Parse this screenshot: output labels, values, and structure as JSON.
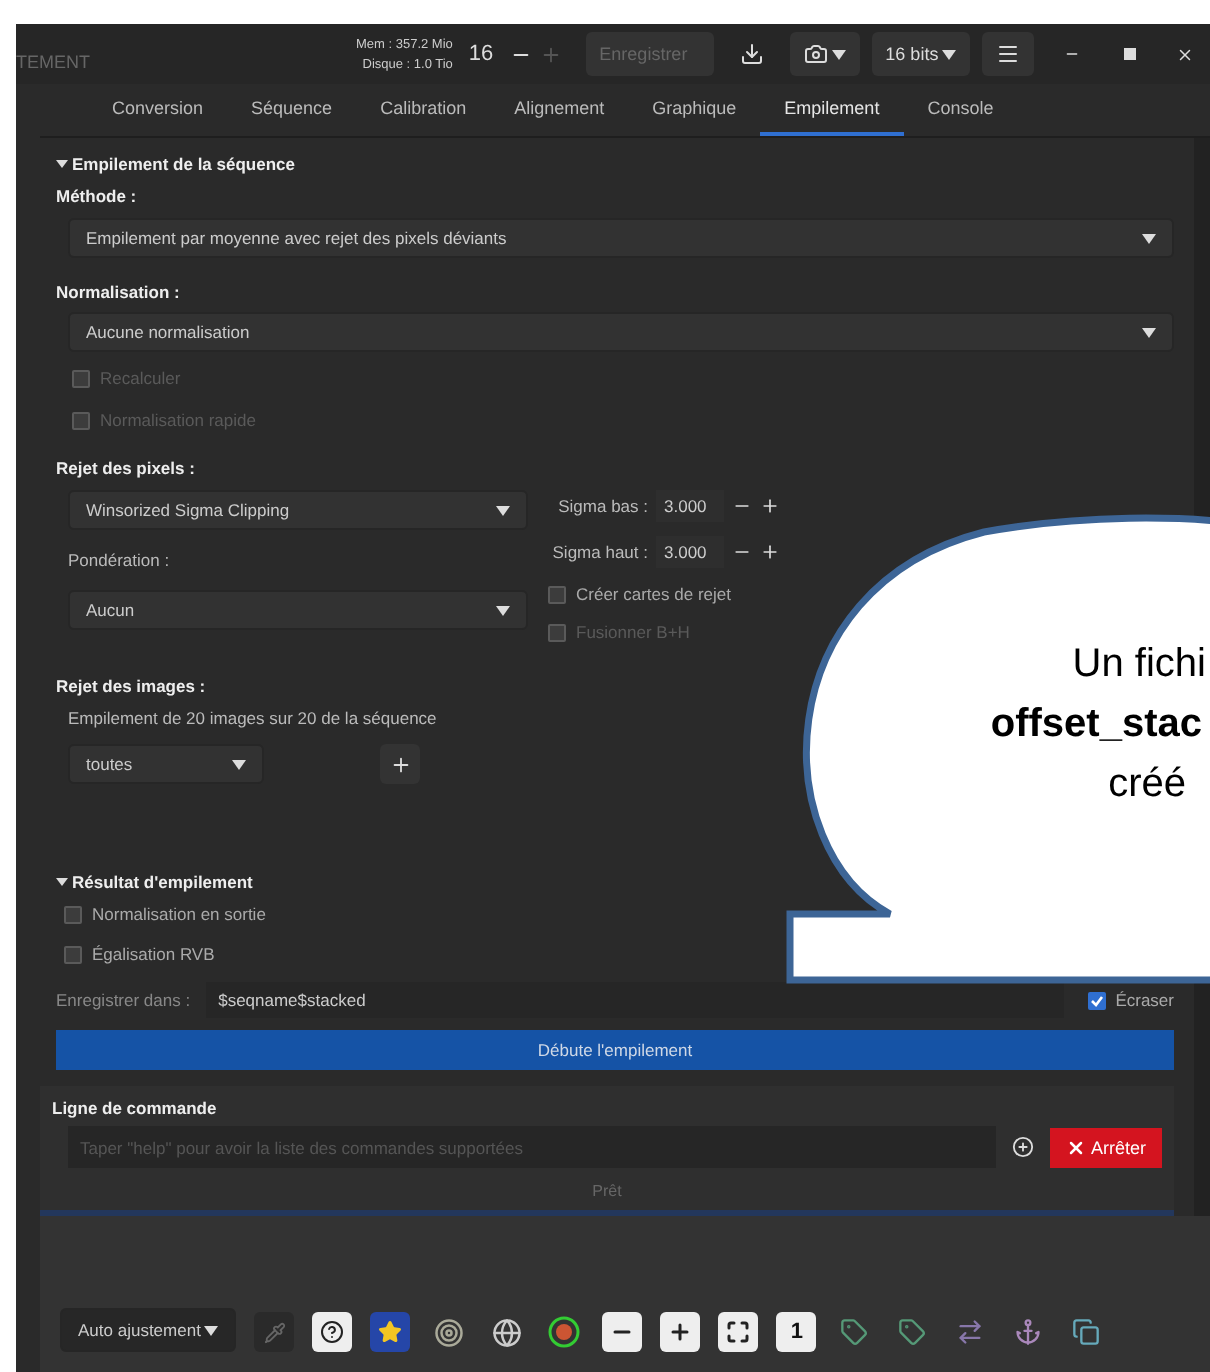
{
  "header": {
    "title": "TEMENT",
    "memory": "Mem : 357.2 Mio",
    "disk": "Disque : 1.0 Tio",
    "bit_count": "16",
    "save_button": {
      "label": "Enregistrer",
      "disabled": true
    },
    "bit_depth": "16 bits"
  },
  "tabs": [
    {
      "label": "Conversion",
      "selected": false
    },
    {
      "label": "Séquence",
      "selected": false
    },
    {
      "label": "Calibration",
      "selected": false
    },
    {
      "label": "Alignement",
      "selected": false
    },
    {
      "label": "Graphique",
      "selected": false
    },
    {
      "label": "Empilement",
      "selected": true
    },
    {
      "label": "Console",
      "selected": false
    }
  ],
  "stacking": {
    "title": "Empilement de la séquence",
    "expanded": true,
    "method_label": "Méthode :",
    "method": "Empilement par moyenne avec rejet des pixels déviants",
    "normalisation_label": "Normalisation :",
    "normalisation": "Aucune normalisation",
    "normalisation_options": [
      {
        "label": "Recalculer",
        "checked": false,
        "disabled": true
      },
      {
        "label": "Normalisation rapide",
        "checked": false,
        "disabled": true
      }
    ],
    "rejection_label": "Rejet des pixels :",
    "rejection": "Winsorized Sigma Clipping",
    "sigma": [
      {
        "label": "Sigma bas :",
        "value": "3.000"
      },
      {
        "label": "Sigma haut :",
        "value": "3.000"
      }
    ],
    "weighting_label": "Pondération :",
    "weighting": "Aucun",
    "rejection_options": [
      {
        "label": "Créer cartes de rejet",
        "checked": false,
        "disabled": false
      },
      {
        "label": "Fusionner B+H",
        "checked": false,
        "disabled": true
      }
    ],
    "image_rejection_label": "Rejet des images :",
    "image_count": "Empilement de 20 images sur 20 de la séquence",
    "image_filter": "toutes"
  },
  "result": {
    "title": "Résultat d'empilement",
    "expanded": true,
    "options": [
      {
        "label": "Normalisation en sortie",
        "checked": false,
        "disabled": false
      },
      {
        "label": "Égalisation RVB",
        "checked": false,
        "disabled": false
      }
    ],
    "save_label": "Enregistrer dans :",
    "save_path": "$seqname$stacked",
    "overwrite": {
      "label": "Écraser",
      "checked": true
    },
    "start_button": "Débute l'empilement"
  },
  "command_line": {
    "title": "Ligne de commande",
    "placeholder": "Taper \"help\" pour avoir la liste des commandes supportées",
    "stop_button": "Arrêter",
    "status": "Prêt"
  },
  "toolbar": {
    "autostretch": "Auto ajustement",
    "zoom_one": "1"
  },
  "callout": {
    "lines": [
      {
        "text": "Un fichi",
        "bold": false
      },
      {
        "text": "offset_stac",
        "bold": true
      },
      {
        "text": "créé",
        "bold": false
      }
    ]
  }
}
